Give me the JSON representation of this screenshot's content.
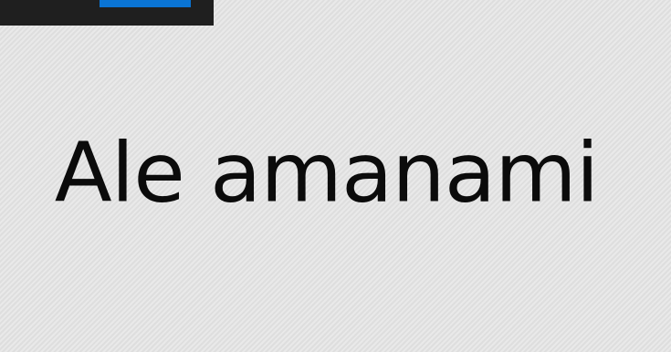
{
  "header": {
    "accent_color": "#0a74d4",
    "bar_color": "#1f1f1f"
  },
  "main": {
    "headline": "Ale amanami"
  }
}
